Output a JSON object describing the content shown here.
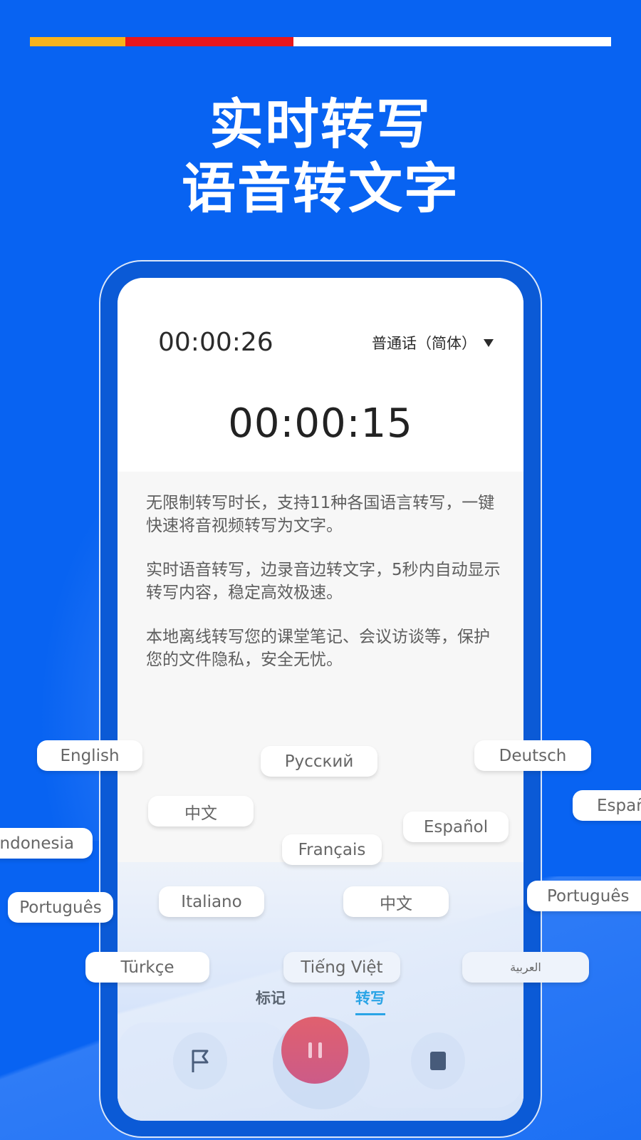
{
  "progress": {
    "segments": [
      {
        "name": "yellow",
        "color": "#f8b31c",
        "fraction": 0.164
      },
      {
        "name": "red",
        "color": "#e8171b",
        "fraction": 0.289
      },
      {
        "name": "remaining",
        "color": "#ffffff",
        "fraction": 0.547
      }
    ]
  },
  "headline": {
    "line1": "实时转写",
    "line2": "语音转文字"
  },
  "phone": {
    "elapsed_time": "00:00:26",
    "language_select": {
      "value": "普通话（简体）",
      "icon": "caret-down-icon"
    },
    "timer": "00:00:15",
    "description": [
      "无限制转写时长，支持11种各国语言转写，一键快速将音视频转写为文字。",
      "实时语音转写，边录音边转文字，5秒内自动显示转写内容，稳定高效极速。",
      "本地离线转写您的课堂笔记、会议访谈等，保护您的文件隐私，安全无忧。"
    ],
    "tabs": [
      {
        "label": "标记",
        "active": false
      },
      {
        "label": "转写",
        "active": true
      }
    ],
    "controls": {
      "flag": "flag-icon",
      "pause": "pause-icon",
      "stop": "stop-icon"
    }
  },
  "languages": [
    {
      "label": "English"
    },
    {
      "label": "Русский"
    },
    {
      "label": "Deutsch"
    },
    {
      "label": "Españ"
    },
    {
      "label": "中文"
    },
    {
      "label": "Español"
    },
    {
      "label": "ndonesia"
    },
    {
      "label": "Français"
    },
    {
      "label": "Português"
    },
    {
      "label": "Italiano"
    },
    {
      "label": "中文"
    },
    {
      "label": "Português"
    },
    {
      "label": "Türkçe"
    },
    {
      "label": "Tiếng Việt"
    },
    {
      "label": "العربية"
    }
  ],
  "colors": {
    "background": "#0863f2",
    "accent_tab": "#2aa4e6",
    "pause_button": "#e0606e"
  }
}
